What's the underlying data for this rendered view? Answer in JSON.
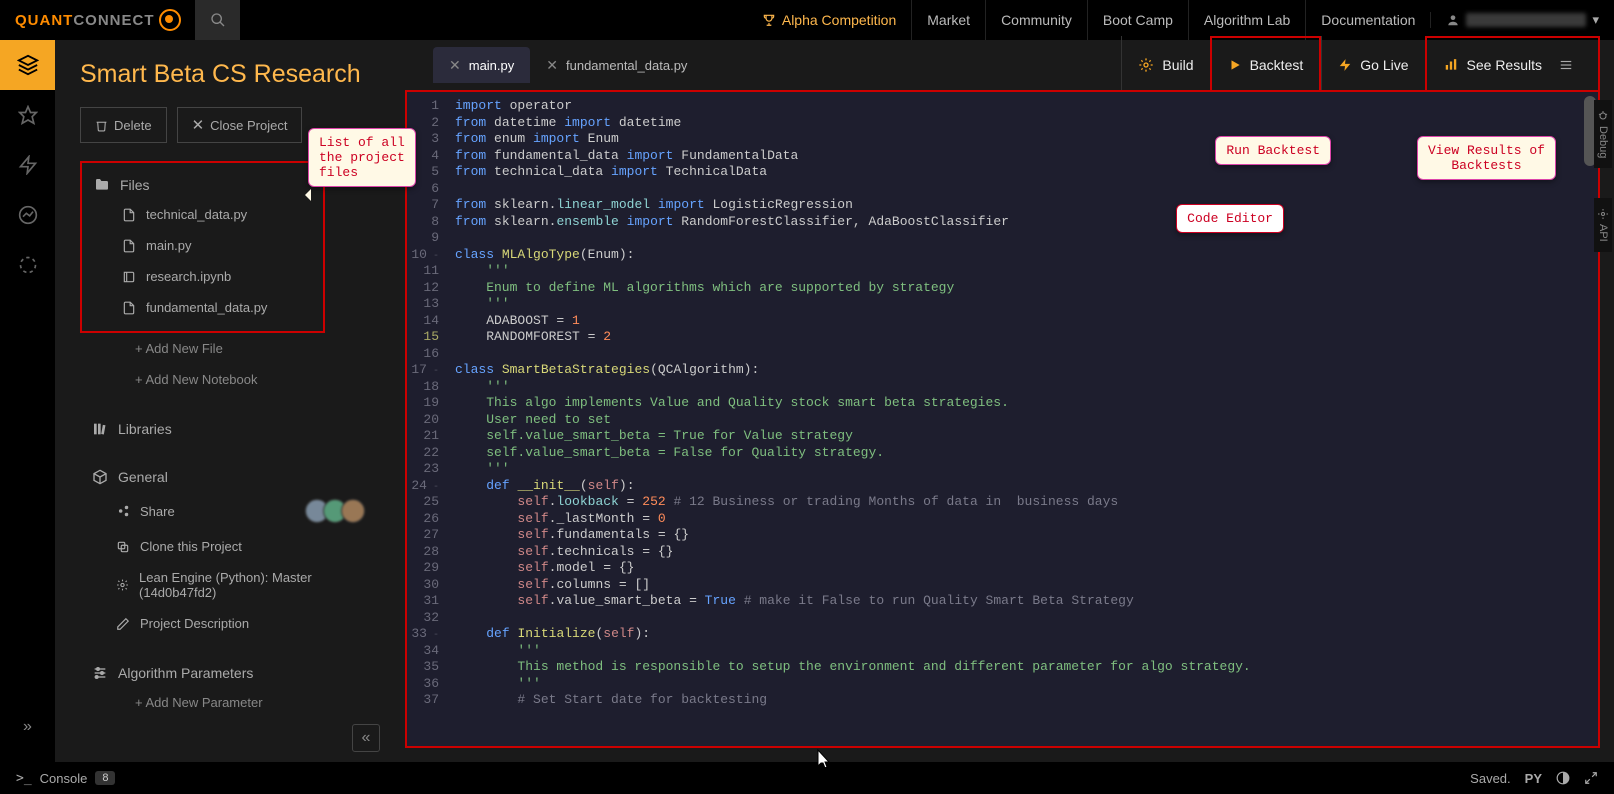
{
  "brand": {
    "part1": "QUANT",
    "part2": "CONNECT"
  },
  "topnav": {
    "alpha": "Alpha Competition",
    "links": [
      "Market",
      "Community",
      "Boot Camp",
      "Algorithm Lab",
      "Documentation"
    ]
  },
  "project": {
    "title": "Smart Beta CS Research",
    "delete": "Delete",
    "close": "Close Project"
  },
  "files": {
    "header": "Files",
    "items": [
      "technical_data.py",
      "main.py",
      "research.ipynb",
      "fundamental_data.py"
    ],
    "add_file": "+  Add New File",
    "add_notebook": "+  Add New Notebook"
  },
  "libraries": {
    "header": "Libraries"
  },
  "general": {
    "header": "General",
    "share": "Share",
    "clone": "Clone this Project",
    "engine": "Lean Engine (Python):   Master (14d0b47fd2)",
    "desc": "Project Description"
  },
  "params": {
    "header": "Algorithm Parameters",
    "add": "+  Add New Parameter"
  },
  "tabs": {
    "main": "main.py",
    "fund": "fundamental_data.py"
  },
  "actions": {
    "build": "Build",
    "backtest": "Backtest",
    "golive": "Go Live",
    "results": "See Results"
  },
  "callouts": {
    "files": "List of all\nthe project\nfiles",
    "editor": "Code Editor",
    "backtest": "Run Backtest",
    "results": "View Results of\nBacktests"
  },
  "right_rail": {
    "debug": "Debug",
    "api": "API"
  },
  "bottom": {
    "console": "Console",
    "console_badge": "8",
    "saved": "Saved.",
    "lang": "PY"
  },
  "code": {
    "lines": [
      {
        "n": 1
      },
      {
        "n": 2
      },
      {
        "n": 3
      },
      {
        "n": 4
      },
      {
        "n": 5
      },
      {
        "n": 6
      },
      {
        "n": 7
      },
      {
        "n": 8
      },
      {
        "n": 9
      },
      {
        "n": 10,
        "fold": true
      },
      {
        "n": 11
      },
      {
        "n": 12
      },
      {
        "n": 13
      },
      {
        "n": 14
      },
      {
        "n": 15,
        "hl": true
      },
      {
        "n": 16
      },
      {
        "n": 17,
        "fold": true
      },
      {
        "n": 18
      },
      {
        "n": 19
      },
      {
        "n": 20
      },
      {
        "n": 21
      },
      {
        "n": 22
      },
      {
        "n": 23
      },
      {
        "n": 24,
        "fold": true
      },
      {
        "n": 25
      },
      {
        "n": 26
      },
      {
        "n": 27
      },
      {
        "n": 28
      },
      {
        "n": 29
      },
      {
        "n": 30
      },
      {
        "n": 31
      },
      {
        "n": 32
      },
      {
        "n": 33,
        "fold": true
      },
      {
        "n": 34
      },
      {
        "n": 35
      },
      {
        "n": 36
      },
      {
        "n": 37
      }
    ]
  }
}
